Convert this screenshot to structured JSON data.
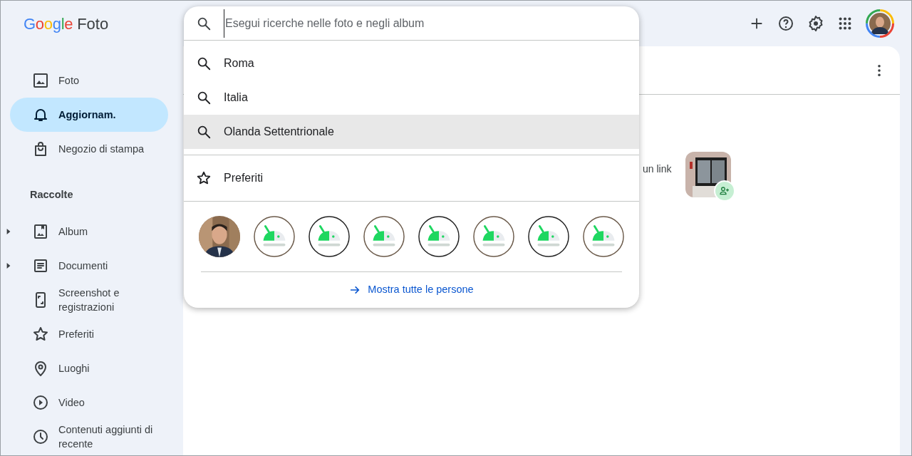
{
  "app": {
    "logo": "Google",
    "name": "Foto"
  },
  "sidebar": {
    "items": [
      {
        "label": "Foto",
        "selected": false
      },
      {
        "label": "Aggiornam.",
        "kind": "bell",
        "selected": true
      },
      {
        "label": "Negozio di stampa",
        "kind": "bag",
        "selected": false
      }
    ],
    "section_title": "Raccolte",
    "collections": [
      {
        "label": "Album",
        "kind": "album",
        "expanded": false,
        "selected": false
      },
      {
        "label": "Documenti",
        "kind": "document",
        "expanded": false,
        "selected": false
      },
      {
        "label": "Screenshot e registrazioni",
        "kind": "phone",
        "selected": false
      },
      {
        "label": "Preferiti",
        "kind": "star",
        "selected": false
      },
      {
        "label": "Luoghi",
        "kind": "pin",
        "selected": false
      },
      {
        "label": "Video",
        "kind": "play",
        "selected": false
      },
      {
        "label": "Contenuti aggiunti di recente",
        "kind": "clock",
        "selected": false
      }
    ]
  },
  "search": {
    "placeholder": "Esegui ricerche nelle foto e negli album",
    "suggestions": [
      {
        "label": "Roma",
        "kind": "search",
        "selected": false
      },
      {
        "label": "Italia",
        "kind": "search",
        "selected": false
      },
      {
        "label": "Olanda Settentrionale",
        "kind": "search",
        "selected": true
      }
    ],
    "favorites": [
      {
        "label": "Preferiti",
        "kind": "star",
        "selected": false
      }
    ],
    "people": [
      {
        "kind": "person"
      },
      {
        "kind": "logo"
      },
      {
        "kind": "logo"
      },
      {
        "kind": "logo"
      },
      {
        "kind": "logo"
      },
      {
        "kind": "logo"
      },
      {
        "kind": "logo"
      },
      {
        "kind": "logo"
      }
    ],
    "show_all": "Mostra tutte le persone"
  },
  "content": {
    "text": "un link"
  }
}
